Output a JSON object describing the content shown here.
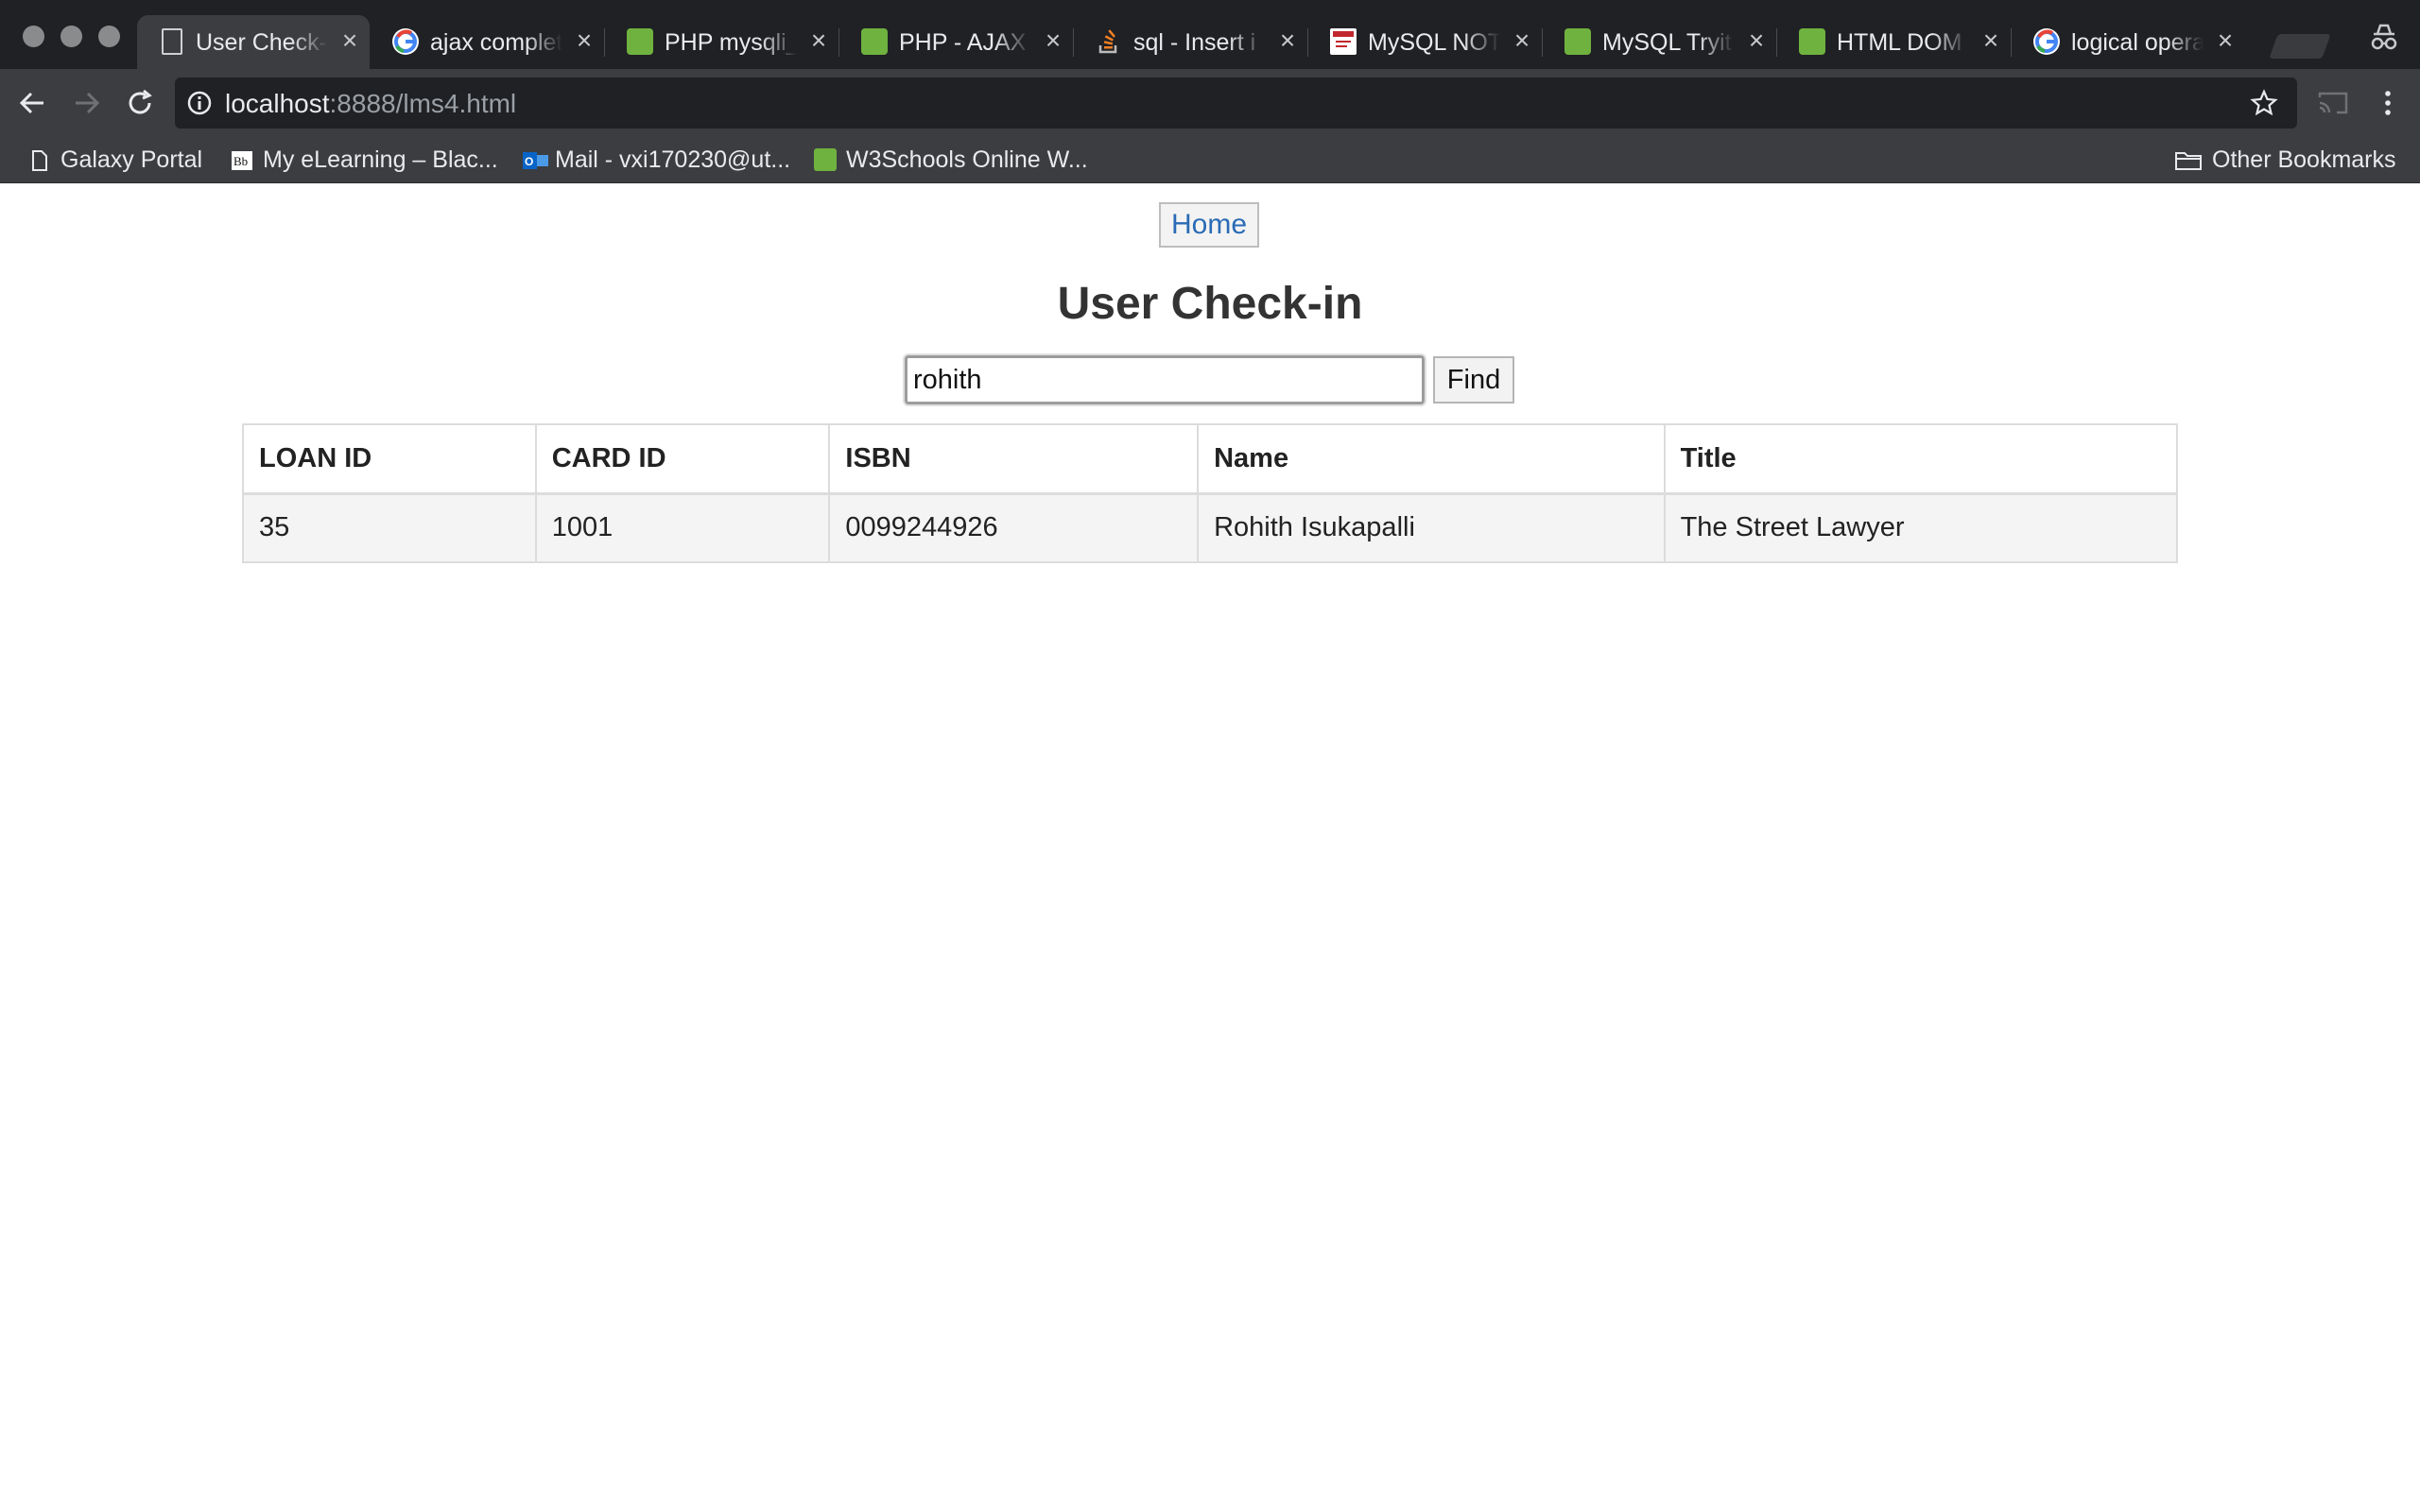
{
  "browser": {
    "tabs": [
      {
        "title": "User Check-",
        "favicon": "document-icon",
        "active": true
      },
      {
        "title": "ajax complet",
        "favicon": "google-icon",
        "active": false
      },
      {
        "title": "PHP mysqli_",
        "favicon": "w3schools-icon",
        "active": false
      },
      {
        "title": "PHP - AJAX",
        "favicon": "w3schools-icon",
        "active": false
      },
      {
        "title": "sql - Insert i",
        "favicon": "stackoverflow-icon",
        "active": false
      },
      {
        "title": "MySQL NOT",
        "favicon": "site-icon",
        "active": false
      },
      {
        "title": "MySQL Tryit",
        "favicon": "w3schools-icon",
        "active": false
      },
      {
        "title": "HTML DOM",
        "favicon": "w3schools-icon",
        "active": false
      },
      {
        "title": "logical opera",
        "favicon": "google-icon",
        "active": false
      }
    ],
    "address": {
      "host": "localhost",
      "rest": ":8888/lms4.html"
    },
    "bookmarks": [
      {
        "label": "Galaxy Portal",
        "icon": "document-icon"
      },
      {
        "label": "My eLearning – Blac...",
        "icon": "blackboard-icon"
      },
      {
        "label": "Mail - vxi170230@ut...",
        "icon": "outlook-icon"
      },
      {
        "label": "W3Schools Online W...",
        "icon": "w3schools-icon"
      }
    ],
    "other_bookmarks": "Other Bookmarks"
  },
  "page": {
    "home_label": "Home",
    "title": "User Check-in",
    "search_value": "rohith",
    "find_label": "Find",
    "table": {
      "headers": [
        "LOAN ID",
        "CARD ID",
        "ISBN",
        "Name",
        "Title"
      ],
      "rows": [
        [
          "35",
          "1001",
          "0099244926",
          "Rohith Isukapalli",
          "The Street Lawyer"
        ]
      ]
    }
  },
  "colors": {
    "tab_bg": "#202124",
    "toolbar_bg": "#3c3d40",
    "link_blue": "#2a6bb5",
    "w3_green": "#6fb23f"
  }
}
